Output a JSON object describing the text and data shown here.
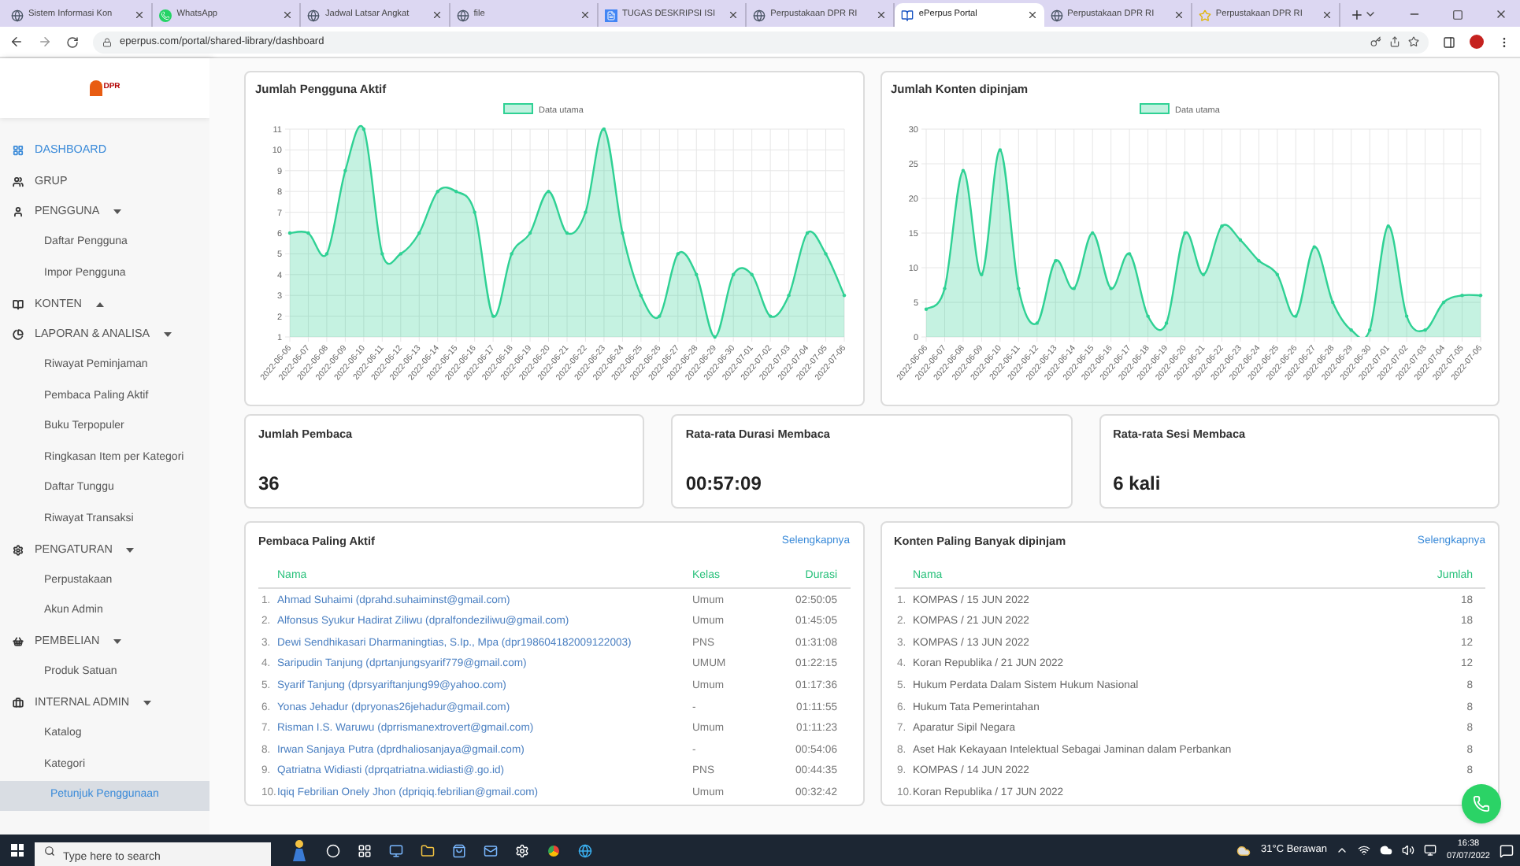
{
  "browser": {
    "tabs": [
      {
        "title": "Sistem Informasi Kon",
        "selected": false
      },
      {
        "title": "WhatsApp",
        "selected": false
      },
      {
        "title": "Jadwal Latsar Angkat",
        "selected": false
      },
      {
        "title": "file",
        "selected": false
      },
      {
        "title": "TUGAS DESKRIPSI ISI",
        "selected": false
      },
      {
        "title": "Perpustakaan DPR RI",
        "selected": false
      },
      {
        "title": "ePerpus Portal",
        "selected": true
      },
      {
        "title": "Perpustakaan DPR RI",
        "selected": false
      },
      {
        "title": "Perpustakaan DPR RI",
        "selected": false
      }
    ],
    "url": "eperpus.com/portal/shared-library/dashboard"
  },
  "sidebar": {
    "logo": "DPR",
    "items": [
      {
        "kind": "link",
        "label": "DASHBOARD",
        "selected": true
      },
      {
        "kind": "link",
        "label": "GRUP",
        "selected": false
      },
      {
        "kind": "menu",
        "label": "PENGGUNA",
        "selected": false,
        "expanded": true,
        "children": [
          {
            "label": "Daftar Pengguna",
            "selected": false
          },
          {
            "label": "Impor Pengguna",
            "selected": false
          }
        ]
      },
      {
        "kind": "menu",
        "label": "KONTEN",
        "selected": false,
        "expanded": false
      },
      {
        "kind": "menu",
        "label": "LAPORAN & ANALISA",
        "selected": false,
        "expanded": true,
        "children": [
          {
            "label": "Riwayat Peminjaman",
            "selected": false
          },
          {
            "label": "Pembaca Paling Aktif",
            "selected": false
          },
          {
            "label": "Buku Terpopuler",
            "selected": false
          },
          {
            "label": "Ringkasan Item per Kategori",
            "selected": false
          },
          {
            "label": "Daftar Tunggu",
            "selected": false
          },
          {
            "label": "Riwayat Transaksi",
            "selected": false
          }
        ]
      },
      {
        "kind": "menu",
        "label": "PENGATURAN",
        "selected": false,
        "expanded": true,
        "children": [
          {
            "label": "Perpustakaan",
            "selected": false
          },
          {
            "label": "Akun Admin",
            "selected": false
          }
        ]
      },
      {
        "kind": "menu",
        "label": "PEMBELIAN",
        "selected": false,
        "expanded": true,
        "children": [
          {
            "label": "Produk Satuan",
            "selected": false
          }
        ]
      },
      {
        "kind": "menu",
        "label": "INTERNAL ADMIN",
        "selected": false,
        "expanded": true,
        "children": [
          {
            "label": "Katalog",
            "selected": false
          },
          {
            "label": "Kategori",
            "selected": false
          },
          {
            "label": "Petunjuk Penggunaan",
            "selected": true
          }
        ]
      }
    ]
  },
  "charts": [
    {
      "chart_data": {
        "type": "area",
        "title": "Jumlah Pengguna Aktif",
        "categories": [
          "2022-06-06",
          "2022-06-07",
          "2022-06-08",
          "2022-06-09",
          "2022-06-10",
          "2022-06-11",
          "2022-06-12",
          "2022-06-13",
          "2022-06-14",
          "2022-06-15",
          "2022-06-16",
          "2022-06-17",
          "2022-06-18",
          "2022-06-19",
          "2022-06-20",
          "2022-06-21",
          "2022-06-22",
          "2022-06-23",
          "2022-06-24",
          "2022-06-25",
          "2022-06-26",
          "2022-06-27",
          "2022-06-28",
          "2022-06-29",
          "2022-06-30",
          "2022-07-01",
          "2022-07-02",
          "2022-07-03",
          "2022-07-04",
          "2022-07-05",
          "2022-07-06"
        ],
        "series": [
          {
            "name": "Data utama",
            "color": "#2fd194",
            "values": [
              6,
              6,
              5,
              9,
              11,
              5,
              5,
              6,
              8,
              8,
              7,
              2,
              5,
              6,
              8,
              6,
              7,
              11,
              6,
              3,
              2,
              5,
              4,
              1,
              4,
              4,
              2,
              3,
              6,
              5,
              3
            ]
          }
        ],
        "ylim": [
          1,
          11
        ],
        "yticks": [
          1,
          2,
          3,
          4,
          5,
          6,
          7,
          8,
          9,
          10,
          11
        ],
        "grid": true
      }
    },
    {
      "chart_data": {
        "type": "area",
        "title": "Jumlah Konten dipinjam",
        "categories": [
          "2022-06-06",
          "2022-06-07",
          "2022-06-08",
          "2022-06-09",
          "2022-06-10",
          "2022-06-11",
          "2022-06-12",
          "2022-06-13",
          "2022-06-14",
          "2022-06-15",
          "2022-06-16",
          "2022-06-17",
          "2022-06-18",
          "2022-06-19",
          "2022-06-20",
          "2022-06-21",
          "2022-06-22",
          "2022-06-23",
          "2022-06-24",
          "2022-06-25",
          "2022-06-26",
          "2022-06-27",
          "2022-06-28",
          "2022-06-29",
          "2022-06-30",
          "2022-07-01",
          "2022-07-02",
          "2022-07-03",
          "2022-07-04",
          "2022-07-05",
          "2022-07-06"
        ],
        "series": [
          {
            "name": "Data utama",
            "color": "#2fd194",
            "values": [
              4,
              7,
              24,
              9,
              27,
              7,
              2,
              11,
              7,
              15,
              7,
              12,
              3,
              2,
              15,
              9,
              16,
              14,
              11,
              9,
              3,
              13,
              5,
              1,
              1,
              16,
              3,
              1,
              5,
              6,
              6
            ]
          }
        ],
        "ylim": [
          0,
          30
        ],
        "yticks": [
          0,
          5,
          10,
          15,
          20,
          25,
          30
        ],
        "grid": true
      }
    }
  ],
  "stats": [
    {
      "label": "Jumlah Pembaca",
      "value": "36"
    },
    {
      "label": "Rata-rata Durasi Membaca",
      "value": "00:57:09"
    },
    {
      "label": "Rata-rata Sesi Membaca",
      "value": "6 kali"
    }
  ],
  "readers": {
    "title": "Pembaca Paling Aktif",
    "more": "Selengkapnya",
    "columns": [
      "Nama",
      "Kelas",
      "Durasi"
    ],
    "rows": [
      {
        "no": "1.",
        "name": "Ahmad Suhaimi (dprahd.suhaiminst@gmail.com)",
        "kelas": "Umum",
        "durasi": "02:50:05"
      },
      {
        "no": "2.",
        "name": "Alfonsus Syukur Hadirat Ziliwu (dpralfondeziliwu@gmail.com)",
        "kelas": "Umum",
        "durasi": "01:45:05"
      },
      {
        "no": "3.",
        "name": "Dewi Sendhikasari Dharmaningtias, S.Ip., Mpa (dpr198604182009122003)",
        "kelas": "PNS",
        "durasi": "01:31:08"
      },
      {
        "no": "4.",
        "name": "Saripudin Tanjung (dprtanjungsyarif779@gmail.com)",
        "kelas": "UMUM",
        "durasi": "01:22:15"
      },
      {
        "no": "5.",
        "name": "Syarif Tanjung (dprsyariftanjung99@yahoo.com)",
        "kelas": "Umum",
        "durasi": "01:17:36"
      },
      {
        "no": "6.",
        "name": "Yonas Jehadur (dpryonas26jehadur@gmail.com)",
        "kelas": "-",
        "durasi": "01:11:55"
      },
      {
        "no": "7.",
        "name": "Risman I.S. Waruwu (dprrismanextrovert@gmail.com)",
        "kelas": "Umum",
        "durasi": "01:11:23"
      },
      {
        "no": "8.",
        "name": "Irwan Sanjaya Putra (dprdhaliosanjaya@gmail.com)",
        "kelas": "-",
        "durasi": "00:54:06"
      },
      {
        "no": "9.",
        "name": "Qatriatna Widiasti (dprqatriatna.widiasti@.go.id)",
        "kelas": "PNS",
        "durasi": "00:44:35"
      },
      {
        "no": "10.",
        "name": "Iqiq Febrilian Onely Jhon (dpriqiq.febrilian@gmail.com)",
        "kelas": "Umum",
        "durasi": "00:32:42"
      }
    ]
  },
  "contents": {
    "title": "Konten Paling Banyak dipinjam",
    "more": "Selengkapnya",
    "columns": [
      "Nama",
      "Jumlah"
    ],
    "rows": [
      {
        "no": "1.",
        "name": "KOMPAS / 15 JUN 2022",
        "jumlah": "18"
      },
      {
        "no": "2.",
        "name": "KOMPAS / 21 JUN 2022",
        "jumlah": "18"
      },
      {
        "no": "3.",
        "name": "KOMPAS / 13 JUN 2022",
        "jumlah": "12"
      },
      {
        "no": "4.",
        "name": "Koran Republika / 21 JUN 2022",
        "jumlah": "12"
      },
      {
        "no": "5.",
        "name": "Hukum Perdata Dalam Sistem Hukum Nasional",
        "jumlah": "8"
      },
      {
        "no": "6.",
        "name": "Hukum Tata Pemerintahan",
        "jumlah": "8"
      },
      {
        "no": "7.",
        "name": "Aparatur Sipil Negara",
        "jumlah": "8"
      },
      {
        "no": "8.",
        "name": "Aset Hak Kekayaan Intelektual Sebagai Jaminan dalam Perbankan",
        "jumlah": "8"
      },
      {
        "no": "9.",
        "name": "KOMPAS / 14 JUN 2022",
        "jumlah": "8"
      },
      {
        "no": "10.",
        "name": "Koran Republika / 17 JUN 2022"
      }
    ]
  },
  "taskbar": {
    "search_placeholder": "Type here to search",
    "weather": "31°C Berawan",
    "time": "16:38",
    "date": "07/07/2022"
  }
}
